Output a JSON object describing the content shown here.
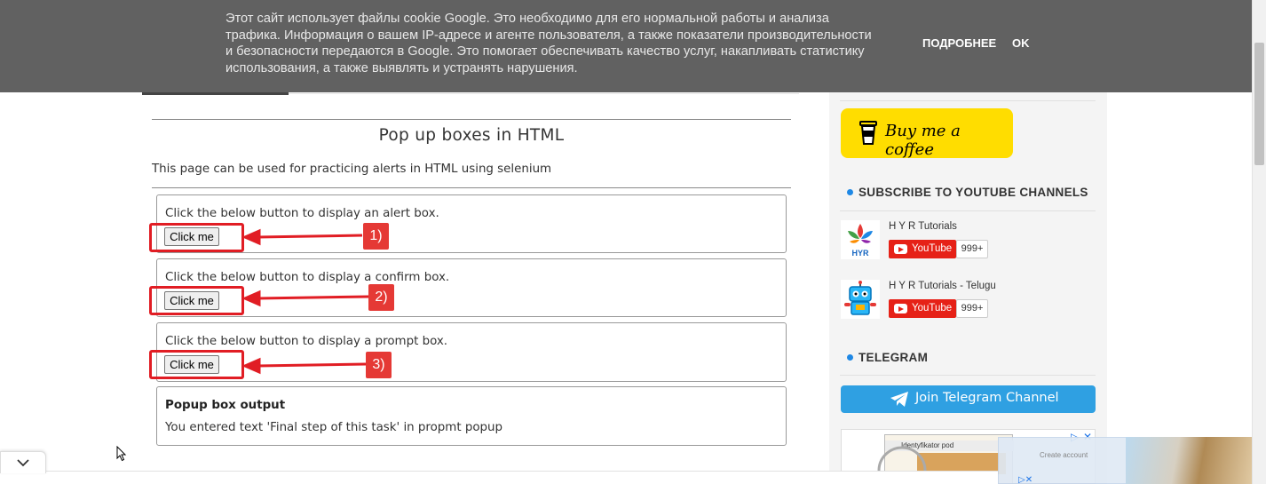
{
  "cookie_banner": {
    "text_lines": [
      "Этот сайт использует файлы cookie Google. Это необходимо для его нормальной работы и анализа",
      "трафика. Информация о вашем IP-адресе и агенте пользователя, а также показатели производительности",
      "и безопасности передаются в Google. Это помогает обеспечивать качество услуг, накапливать статистику",
      "использования, а также выявлять и устранять нарушения."
    ],
    "more_label": "ПОДРОБНЕЕ",
    "ok_label": "OK"
  },
  "main": {
    "title": "Pop up boxes in HTML",
    "description": "This page can be used for practicing alerts in HTML using selenium",
    "alert_box": {
      "text": "Click the below button to display an alert box.",
      "button": "Click me"
    },
    "confirm_box": {
      "text": "Click the below button to display a confirm box.",
      "button": "Click me"
    },
    "prompt_box": {
      "text": "Click the below button to display a prompt box.",
      "button": "Click me"
    },
    "output_box": {
      "title": "Popup box output",
      "text": "You entered text 'Final step of this task' in propmt popup"
    }
  },
  "annotations": {
    "labels": [
      "1)",
      "2)",
      "3)"
    ],
    "color": "#e11d24"
  },
  "sidebar": {
    "coffee_label": "Buy me a coffee",
    "subscribe_heading": "SUBSCRIBE TO YOUTUBE CHANNELS",
    "channels": [
      {
        "name": "H Y R Tutorials",
        "button": "YouTube",
        "count": "999+",
        "logo_text": "HYR"
      },
      {
        "name": "H Y R Tutorials - Telugu",
        "button": "YouTube",
        "count": "999+"
      }
    ],
    "telegram_heading": "TELEGRAM",
    "telegram_button": "Join Telegram Channel",
    "ad_text": "Identyfikator pod",
    "ad_create_account": "Create account"
  },
  "colors": {
    "banner": "#616161",
    "youtube": "#e62117",
    "telegram": "#2fa0e2",
    "coffee": "#ffdd00",
    "heading_dot": "#1e88e5"
  }
}
